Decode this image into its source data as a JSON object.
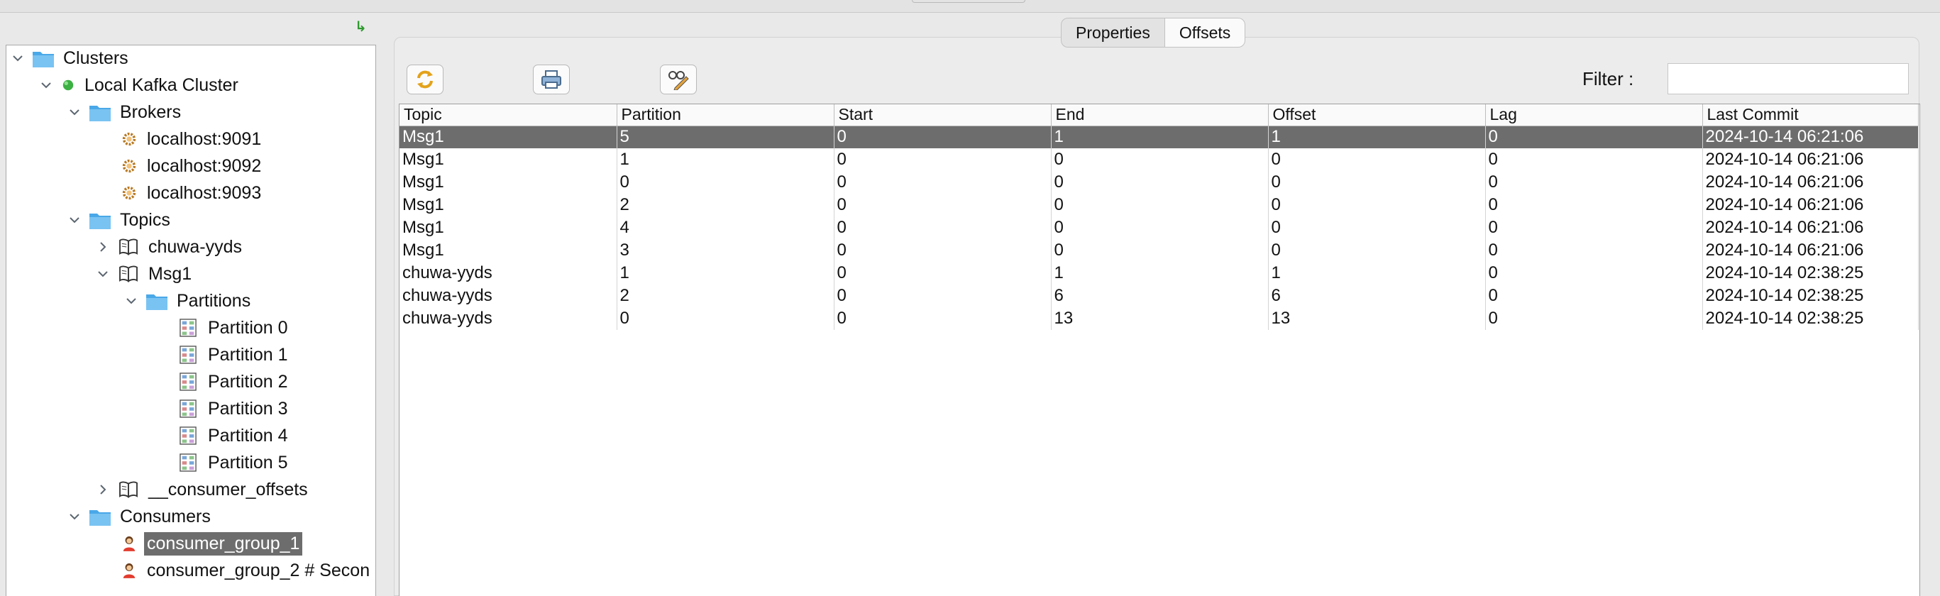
{
  "tree": {
    "clusters_label": "Clusters",
    "cluster_label": "Local Kafka Cluster",
    "brokers_label": "Brokers",
    "brokers": [
      "localhost:9091",
      "localhost:9092",
      "localhost:9093"
    ],
    "topics_label": "Topics",
    "topic_chuwa": "chuwa-yyds",
    "topic_msg1": "Msg1",
    "partitions_label": "Partitions",
    "partitions": [
      "Partition 0",
      "Partition 1",
      "Partition 2",
      "Partition 3",
      "Partition 4",
      "Partition 5"
    ],
    "topic_consumer_offsets": "__consumer_offsets",
    "consumers_label": "Consumers",
    "consumers": [
      "consumer_group_1",
      "consumer_group_2 # Secon"
    ]
  },
  "tabs": [
    {
      "label": "Properties"
    },
    {
      "label": "Offsets"
    }
  ],
  "toolbar": {
    "filter_label": "Filter :",
    "filter_value": ""
  },
  "icons": {
    "refresh": "refresh-icon",
    "print": "print-icon",
    "edit": "edit-icon",
    "collapse": "collapse-arrow-icon"
  },
  "colors": {
    "selection": "#6d6d6d",
    "status_connected": "#3cb043",
    "folder": "#4aa8e8"
  },
  "table": {
    "columns": [
      "Topic",
      "Partition",
      "Start",
      "End",
      "Offset",
      "Lag",
      "Last Commit"
    ],
    "rows": [
      [
        "Msg1",
        "5",
        "0",
        "1",
        "1",
        "0",
        "2024-10-14 06:21:06"
      ],
      [
        "Msg1",
        "1",
        "0",
        "0",
        "0",
        "0",
        "2024-10-14 06:21:06"
      ],
      [
        "Msg1",
        "0",
        "0",
        "0",
        "0",
        "0",
        "2024-10-14 06:21:06"
      ],
      [
        "Msg1",
        "2",
        "0",
        "0",
        "0",
        "0",
        "2024-10-14 06:21:06"
      ],
      [
        "Msg1",
        "4",
        "0",
        "0",
        "0",
        "0",
        "2024-10-14 06:21:06"
      ],
      [
        "Msg1",
        "3",
        "0",
        "0",
        "0",
        "0",
        "2024-10-14 06:21:06"
      ],
      [
        "chuwa-yyds",
        "1",
        "0",
        "1",
        "1",
        "0",
        "2024-10-14 02:38:25"
      ],
      [
        "chuwa-yyds",
        "2",
        "0",
        "6",
        "6",
        "0",
        "2024-10-14 02:38:25"
      ],
      [
        "chuwa-yyds",
        "0",
        "0",
        "13",
        "13",
        "0",
        "2024-10-14 02:38:25"
      ]
    ]
  }
}
